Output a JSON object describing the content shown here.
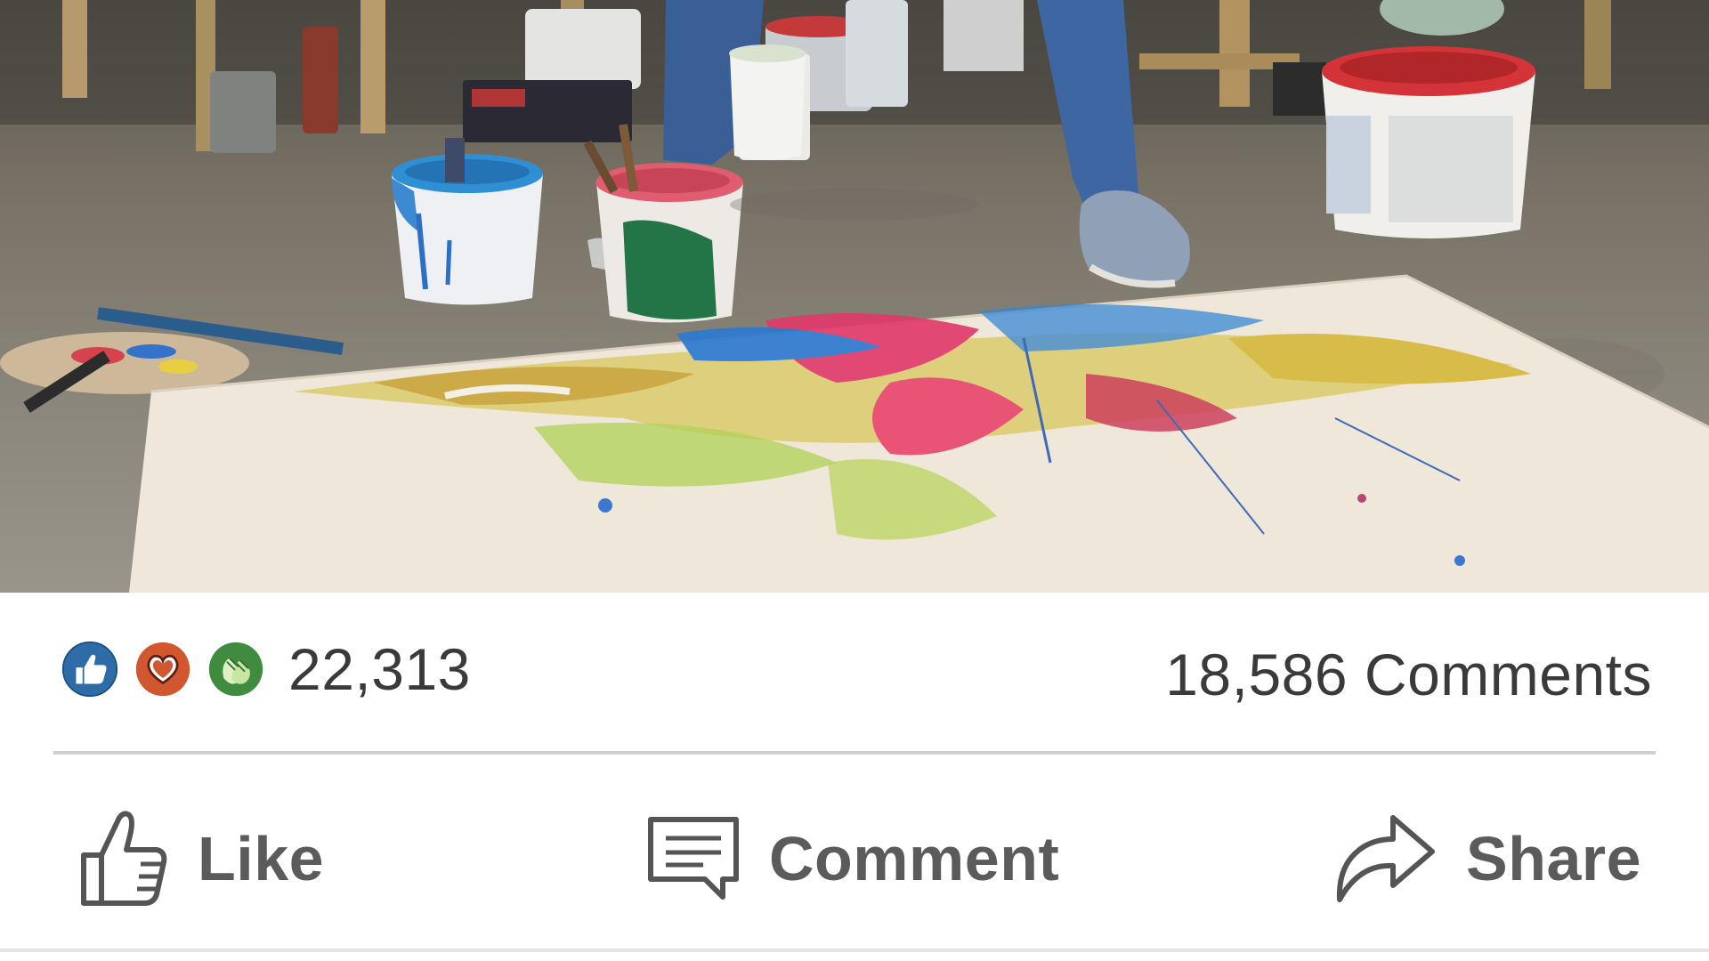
{
  "reactions": {
    "icons": [
      "like-reaction",
      "love-reaction",
      "celebrate-reaction"
    ],
    "colors": {
      "like": "#2e6ca8",
      "love": "#d0572f",
      "celebrate": "#3f8b3f"
    },
    "count": "22,313"
  },
  "comments": {
    "count_label": "18,586 Comments"
  },
  "actions": {
    "like_label": "Like",
    "comment_label": "Comment",
    "share_label": "Share"
  }
}
